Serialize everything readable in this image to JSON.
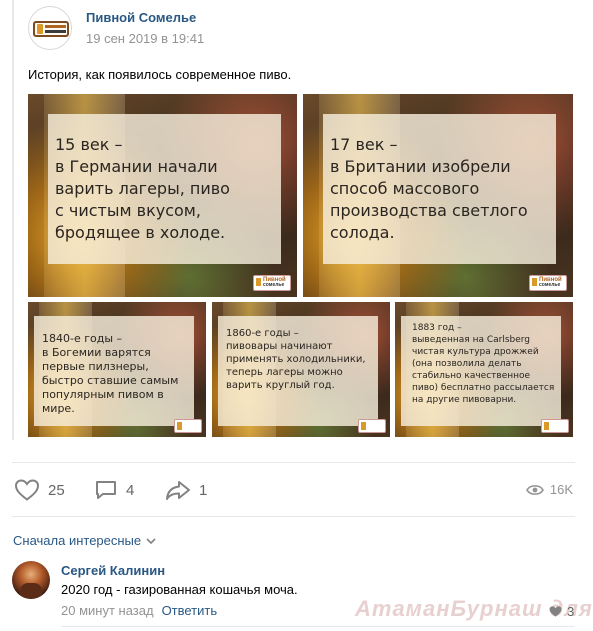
{
  "post": {
    "author": "Пивной Сомелье",
    "date": "19 сен 2019 в 19:41",
    "text": "История, как появилось современное пиво.",
    "images": [
      {
        "caption": "15 век –\nв Германии начали\nварить лагеры, пиво\nс чистым вкусом,\nбродящее в холоде."
      },
      {
        "caption": "17 век –\nв Британии изобрели\nспособ массового\nпроизводства светлого\nсолода."
      },
      {
        "caption": "1840-е годы –\nв Богемии варятся\nпервые пилзнеры,\nбыстро ставшие самым\nпопулярным пивом в\nмире."
      },
      {
        "caption": "1860-е годы –\nпивовары начинают\nприменять холодильники,\nтеперь лагеры можно\nварить круглый год."
      },
      {
        "caption": "1883 год –\nвыведенная на Carlsberg\nчистая культура дрожжей\n(она позволила делать\nстабильно качественное\nпиво) бесплатно рассылается\nна другие пивоварни."
      }
    ],
    "brand_icon": "pivnoy-somelye-logo"
  },
  "actions": {
    "likes": "25",
    "comments": "4",
    "shares": "1",
    "views": "16K",
    "like_icon": "heart-icon",
    "comment_icon": "comment-icon",
    "share_icon": "share-icon",
    "views_icon": "eye-icon"
  },
  "comments": {
    "sort_label": "Сначала интересные",
    "items": [
      {
        "author": "Сергей Калинин",
        "text": "2020 год - газированная кошачья моча.",
        "time": "20 минут назад",
        "reply_label": "Ответить",
        "likes": "3"
      }
    ]
  },
  "watermark": "АтаманБурнаш для ЯП",
  "colors": {
    "link": "#2a5885",
    "muted": "#939393",
    "divider": "#e7e8ec"
  }
}
